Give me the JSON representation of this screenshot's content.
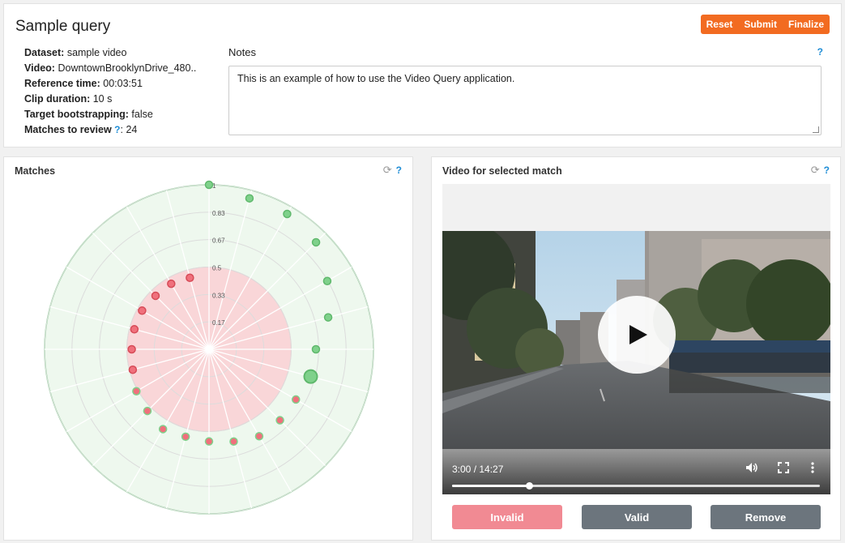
{
  "header": {
    "title": "Sample query",
    "buttons": {
      "reset": "Reset",
      "submit": "Submit",
      "finalize": "Finalize"
    }
  },
  "query_info": {
    "dataset": {
      "label": "Dataset:",
      "value": "sample video"
    },
    "video": {
      "label": "Video:",
      "value": "DowntownBrooklynDrive_480.."
    },
    "reference_time": {
      "label": "Reference time:",
      "value": "00:03:51"
    },
    "clip_duration": {
      "label": "Clip duration:",
      "value": "10 s"
    },
    "target_bootstrapping": {
      "label": "Target bootstrapping:",
      "value": "false"
    },
    "matches_to_review": {
      "label": "Matches to review",
      "help": "?",
      "value": ": 24"
    }
  },
  "notes": {
    "label": "Notes",
    "help": "?",
    "text": "This is an example of how to use the Video Query application."
  },
  "matches_panel": {
    "title": "Matches",
    "help": "?",
    "refresh_icon": "refresh-icon",
    "radial": {
      "ring_labels": [
        "1",
        "0.83",
        "0.67",
        "0.5",
        "0.33",
        "0.17"
      ],
      "threshold": 0.5,
      "colors": {
        "valid": "#7fd18b",
        "invalid": "#f0707c",
        "valid_zone": "#eef8ee",
        "invalid_zone": "#f9d6d8",
        "border": "#7fd18b"
      },
      "points": [
        {
          "angle": 0,
          "r": 1.0,
          "status": "valid"
        },
        {
          "angle": 15,
          "r": 0.95,
          "status": "valid"
        },
        {
          "angle": 30,
          "r": 0.95,
          "status": "valid"
        },
        {
          "angle": 45,
          "r": 0.92,
          "status": "valid"
        },
        {
          "angle": 60,
          "r": 0.83,
          "status": "valid"
        },
        {
          "angle": 75,
          "r": 0.75,
          "status": "valid"
        },
        {
          "angle": 90,
          "r": 0.65,
          "status": "valid"
        },
        {
          "angle": 105,
          "r": 0.64,
          "status": "valid",
          "selected": true
        },
        {
          "angle": 120,
          "r": 0.61,
          "status": "invalid-checked"
        },
        {
          "angle": 135,
          "r": 0.61,
          "status": "invalid-checked"
        },
        {
          "angle": 150,
          "r": 0.61,
          "status": "invalid-checked"
        },
        {
          "angle": 165,
          "r": 0.58,
          "status": "invalid-checked"
        },
        {
          "angle": 180,
          "r": 0.56,
          "status": "invalid-checked"
        },
        {
          "angle": 195,
          "r": 0.55,
          "status": "invalid-checked"
        },
        {
          "angle": 210,
          "r": 0.56,
          "status": "invalid-checked"
        },
        {
          "angle": 225,
          "r": 0.53,
          "status": "invalid-checked"
        },
        {
          "angle": 240,
          "r": 0.51,
          "status": "invalid-checked"
        },
        {
          "angle": 255,
          "r": 0.48,
          "status": "invalid"
        },
        {
          "angle": 270,
          "r": 0.47,
          "status": "invalid"
        },
        {
          "angle": 285,
          "r": 0.47,
          "status": "invalid"
        },
        {
          "angle": 300,
          "r": 0.47,
          "status": "invalid"
        },
        {
          "angle": 315,
          "r": 0.46,
          "status": "invalid"
        },
        {
          "angle": 330,
          "r": 0.46,
          "status": "invalid"
        },
        {
          "angle": 345,
          "r": 0.45,
          "status": "invalid"
        }
      ]
    }
  },
  "video_panel": {
    "title": "Video for selected match",
    "help": "?",
    "refresh_icon": "refresh-icon",
    "player": {
      "time": "3:00 / 14:27",
      "progress": 0.21,
      "play_icon": "play-icon",
      "volume_icon": "volume-icon",
      "fullscreen_icon": "fullscreen-icon",
      "more_icon": "more-icon"
    },
    "buttons": {
      "invalid": "Invalid",
      "valid": "Valid",
      "remove": "Remove"
    }
  }
}
